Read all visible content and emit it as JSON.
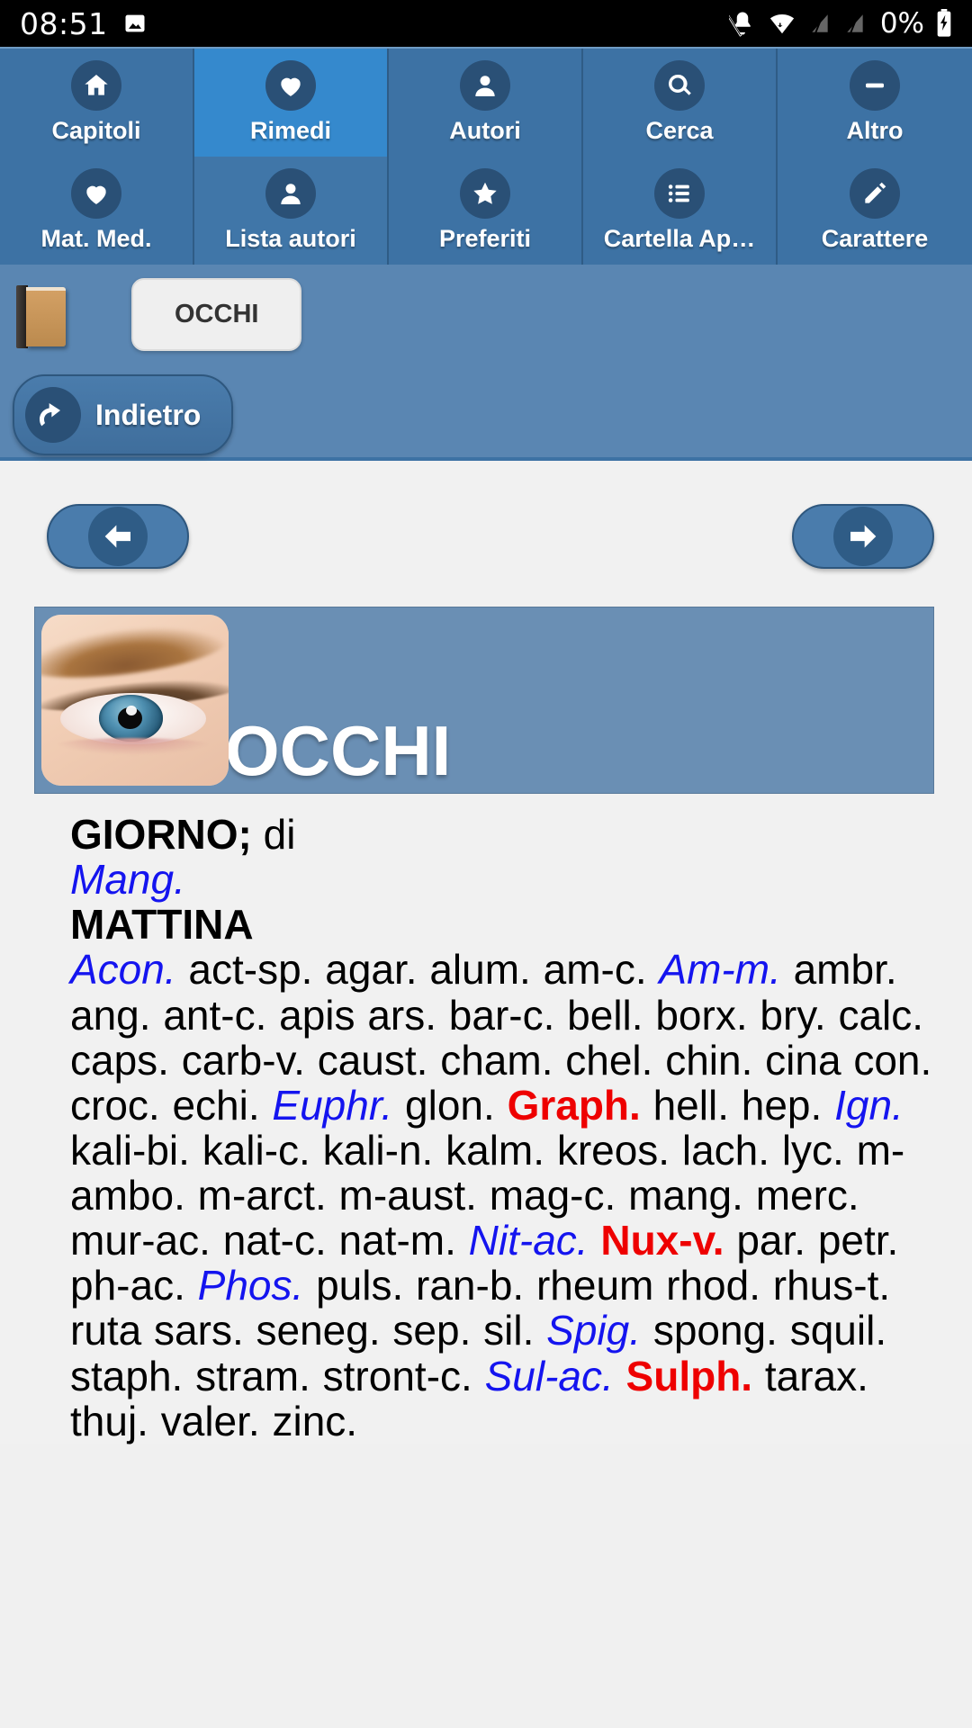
{
  "statusbar": {
    "time": "08:51",
    "battery_percent": "0%",
    "icons": [
      "image-icon",
      "bell-off-icon",
      "wifi-icon",
      "signal-off-icon",
      "signal-off-icon",
      "battery-charging-icon"
    ]
  },
  "toolbar": {
    "active_index": 1,
    "items": [
      {
        "label": "Capitoli",
        "icon": "home-icon"
      },
      {
        "label": "Rimedi",
        "icon": "heart-icon"
      },
      {
        "label": "Autori",
        "icon": "person-icon"
      },
      {
        "label": "Cerca",
        "icon": "search-icon"
      },
      {
        "label": "Altro",
        "icon": "minus-icon"
      },
      {
        "label": "Mat. Med.",
        "icon": "heart-icon"
      },
      {
        "label": "Lista autori",
        "icon": "person-icon"
      },
      {
        "label": "Preferiti",
        "icon": "star-icon"
      },
      {
        "label": "Cartella Ap…",
        "icon": "list-icon"
      },
      {
        "label": "Carattere",
        "icon": "pencil-icon"
      }
    ]
  },
  "breadcrumb": {
    "book_icon": "book-icon",
    "chip_label": "OCCHI"
  },
  "back_button": {
    "label": "Indietro",
    "icon": "undo-arrow-icon"
  },
  "nav": {
    "prev_icon": "arrow-left-icon",
    "next_icon": "arrow-right-icon"
  },
  "banner": {
    "title": "OCCHI",
    "image": "eye-photo"
  },
  "article": {
    "rubric_bold": "GIORNO;",
    "rubric_rest": " di",
    "rubric_remedy": "Mang.",
    "subheading": "MATTINA",
    "remedies": [
      {
        "name": "Acon.",
        "grade": 2
      },
      {
        "name": "act-sp.",
        "grade": 1
      },
      {
        "name": "agar.",
        "grade": 1
      },
      {
        "name": "alum.",
        "grade": 1
      },
      {
        "name": "am-c.",
        "grade": 1
      },
      {
        "name": "Am-m.",
        "grade": 2
      },
      {
        "name": "ambr.",
        "grade": 1
      },
      {
        "name": "ang.",
        "grade": 1
      },
      {
        "name": "ant-c.",
        "grade": 1
      },
      {
        "name": "apis",
        "grade": 1
      },
      {
        "name": "ars.",
        "grade": 1
      },
      {
        "name": "bar-c.",
        "grade": 1
      },
      {
        "name": "bell.",
        "grade": 1
      },
      {
        "name": "borx.",
        "grade": 1
      },
      {
        "name": "bry.",
        "grade": 1
      },
      {
        "name": "calc.",
        "grade": 1
      },
      {
        "name": "caps.",
        "grade": 1
      },
      {
        "name": "carb-v.",
        "grade": 1
      },
      {
        "name": "caust.",
        "grade": 1
      },
      {
        "name": "cham.",
        "grade": 1
      },
      {
        "name": "chel.",
        "grade": 1
      },
      {
        "name": "chin.",
        "grade": 1
      },
      {
        "name": "cina",
        "grade": 1
      },
      {
        "name": "con.",
        "grade": 1
      },
      {
        "name": "croc.",
        "grade": 1
      },
      {
        "name": "echi.",
        "grade": 1
      },
      {
        "name": "Euphr.",
        "grade": 2
      },
      {
        "name": "glon.",
        "grade": 1
      },
      {
        "name": "Graph.",
        "grade": 3
      },
      {
        "name": "hell.",
        "grade": 1
      },
      {
        "name": "hep.",
        "grade": 1
      },
      {
        "name": "Ign.",
        "grade": 2
      },
      {
        "name": "kali-bi.",
        "grade": 1
      },
      {
        "name": "kali-c.",
        "grade": 1
      },
      {
        "name": "kali-n.",
        "grade": 1
      },
      {
        "name": "kalm.",
        "grade": 1
      },
      {
        "name": "kreos.",
        "grade": 1
      },
      {
        "name": "lach.",
        "grade": 1
      },
      {
        "name": "lyc.",
        "grade": 1
      },
      {
        "name": "m-ambo.",
        "grade": 1
      },
      {
        "name": "m-arct.",
        "grade": 1
      },
      {
        "name": "m-aust.",
        "grade": 1
      },
      {
        "name": "mag-c.",
        "grade": 1
      },
      {
        "name": "mang.",
        "grade": 1
      },
      {
        "name": "merc.",
        "grade": 1
      },
      {
        "name": "mur-ac.",
        "grade": 1
      },
      {
        "name": "nat-c.",
        "grade": 1
      },
      {
        "name": "nat-m.",
        "grade": 1
      },
      {
        "name": "Nit-ac.",
        "grade": 2
      },
      {
        "name": "Nux-v.",
        "grade": 3
      },
      {
        "name": "par.",
        "grade": 1
      },
      {
        "name": "petr.",
        "grade": 1
      },
      {
        "name": "ph-ac.",
        "grade": 1
      },
      {
        "name": "Phos.",
        "grade": 2
      },
      {
        "name": "puls.",
        "grade": 1
      },
      {
        "name": "ran-b.",
        "grade": 1
      },
      {
        "name": "rheum",
        "grade": 1
      },
      {
        "name": "rhod.",
        "grade": 1
      },
      {
        "name": "rhus-t.",
        "grade": 1
      },
      {
        "name": "ruta",
        "grade": 1
      },
      {
        "name": "sars.",
        "grade": 1
      },
      {
        "name": "seneg.",
        "grade": 1
      },
      {
        "name": "sep.",
        "grade": 1
      },
      {
        "name": "sil.",
        "grade": 1
      },
      {
        "name": "Spig.",
        "grade": 2
      },
      {
        "name": "spong.",
        "grade": 1
      },
      {
        "name": "squil.",
        "grade": 1
      },
      {
        "name": "staph.",
        "grade": 1
      },
      {
        "name": "stram.",
        "grade": 1
      },
      {
        "name": "stront-c.",
        "grade": 1
      },
      {
        "name": "Sul-ac.",
        "grade": 2
      },
      {
        "name": "Sulph.",
        "grade": 3
      },
      {
        "name": "tarax.",
        "grade": 1
      },
      {
        "name": "thuj.",
        "grade": 1
      },
      {
        "name": "valer.",
        "grade": 1
      },
      {
        "name": "zinc.",
        "grade": 1
      }
    ]
  },
  "colors": {
    "toolbar_bg": "#3d72a4",
    "toolbar_active": "#3589cd",
    "breadcrumb_bg": "#5a86b2",
    "banner_bg": "#6a8fb4",
    "content_bg": "#f1f1f1",
    "grade2": "#1414ef",
    "grade3": "#ee0000"
  }
}
